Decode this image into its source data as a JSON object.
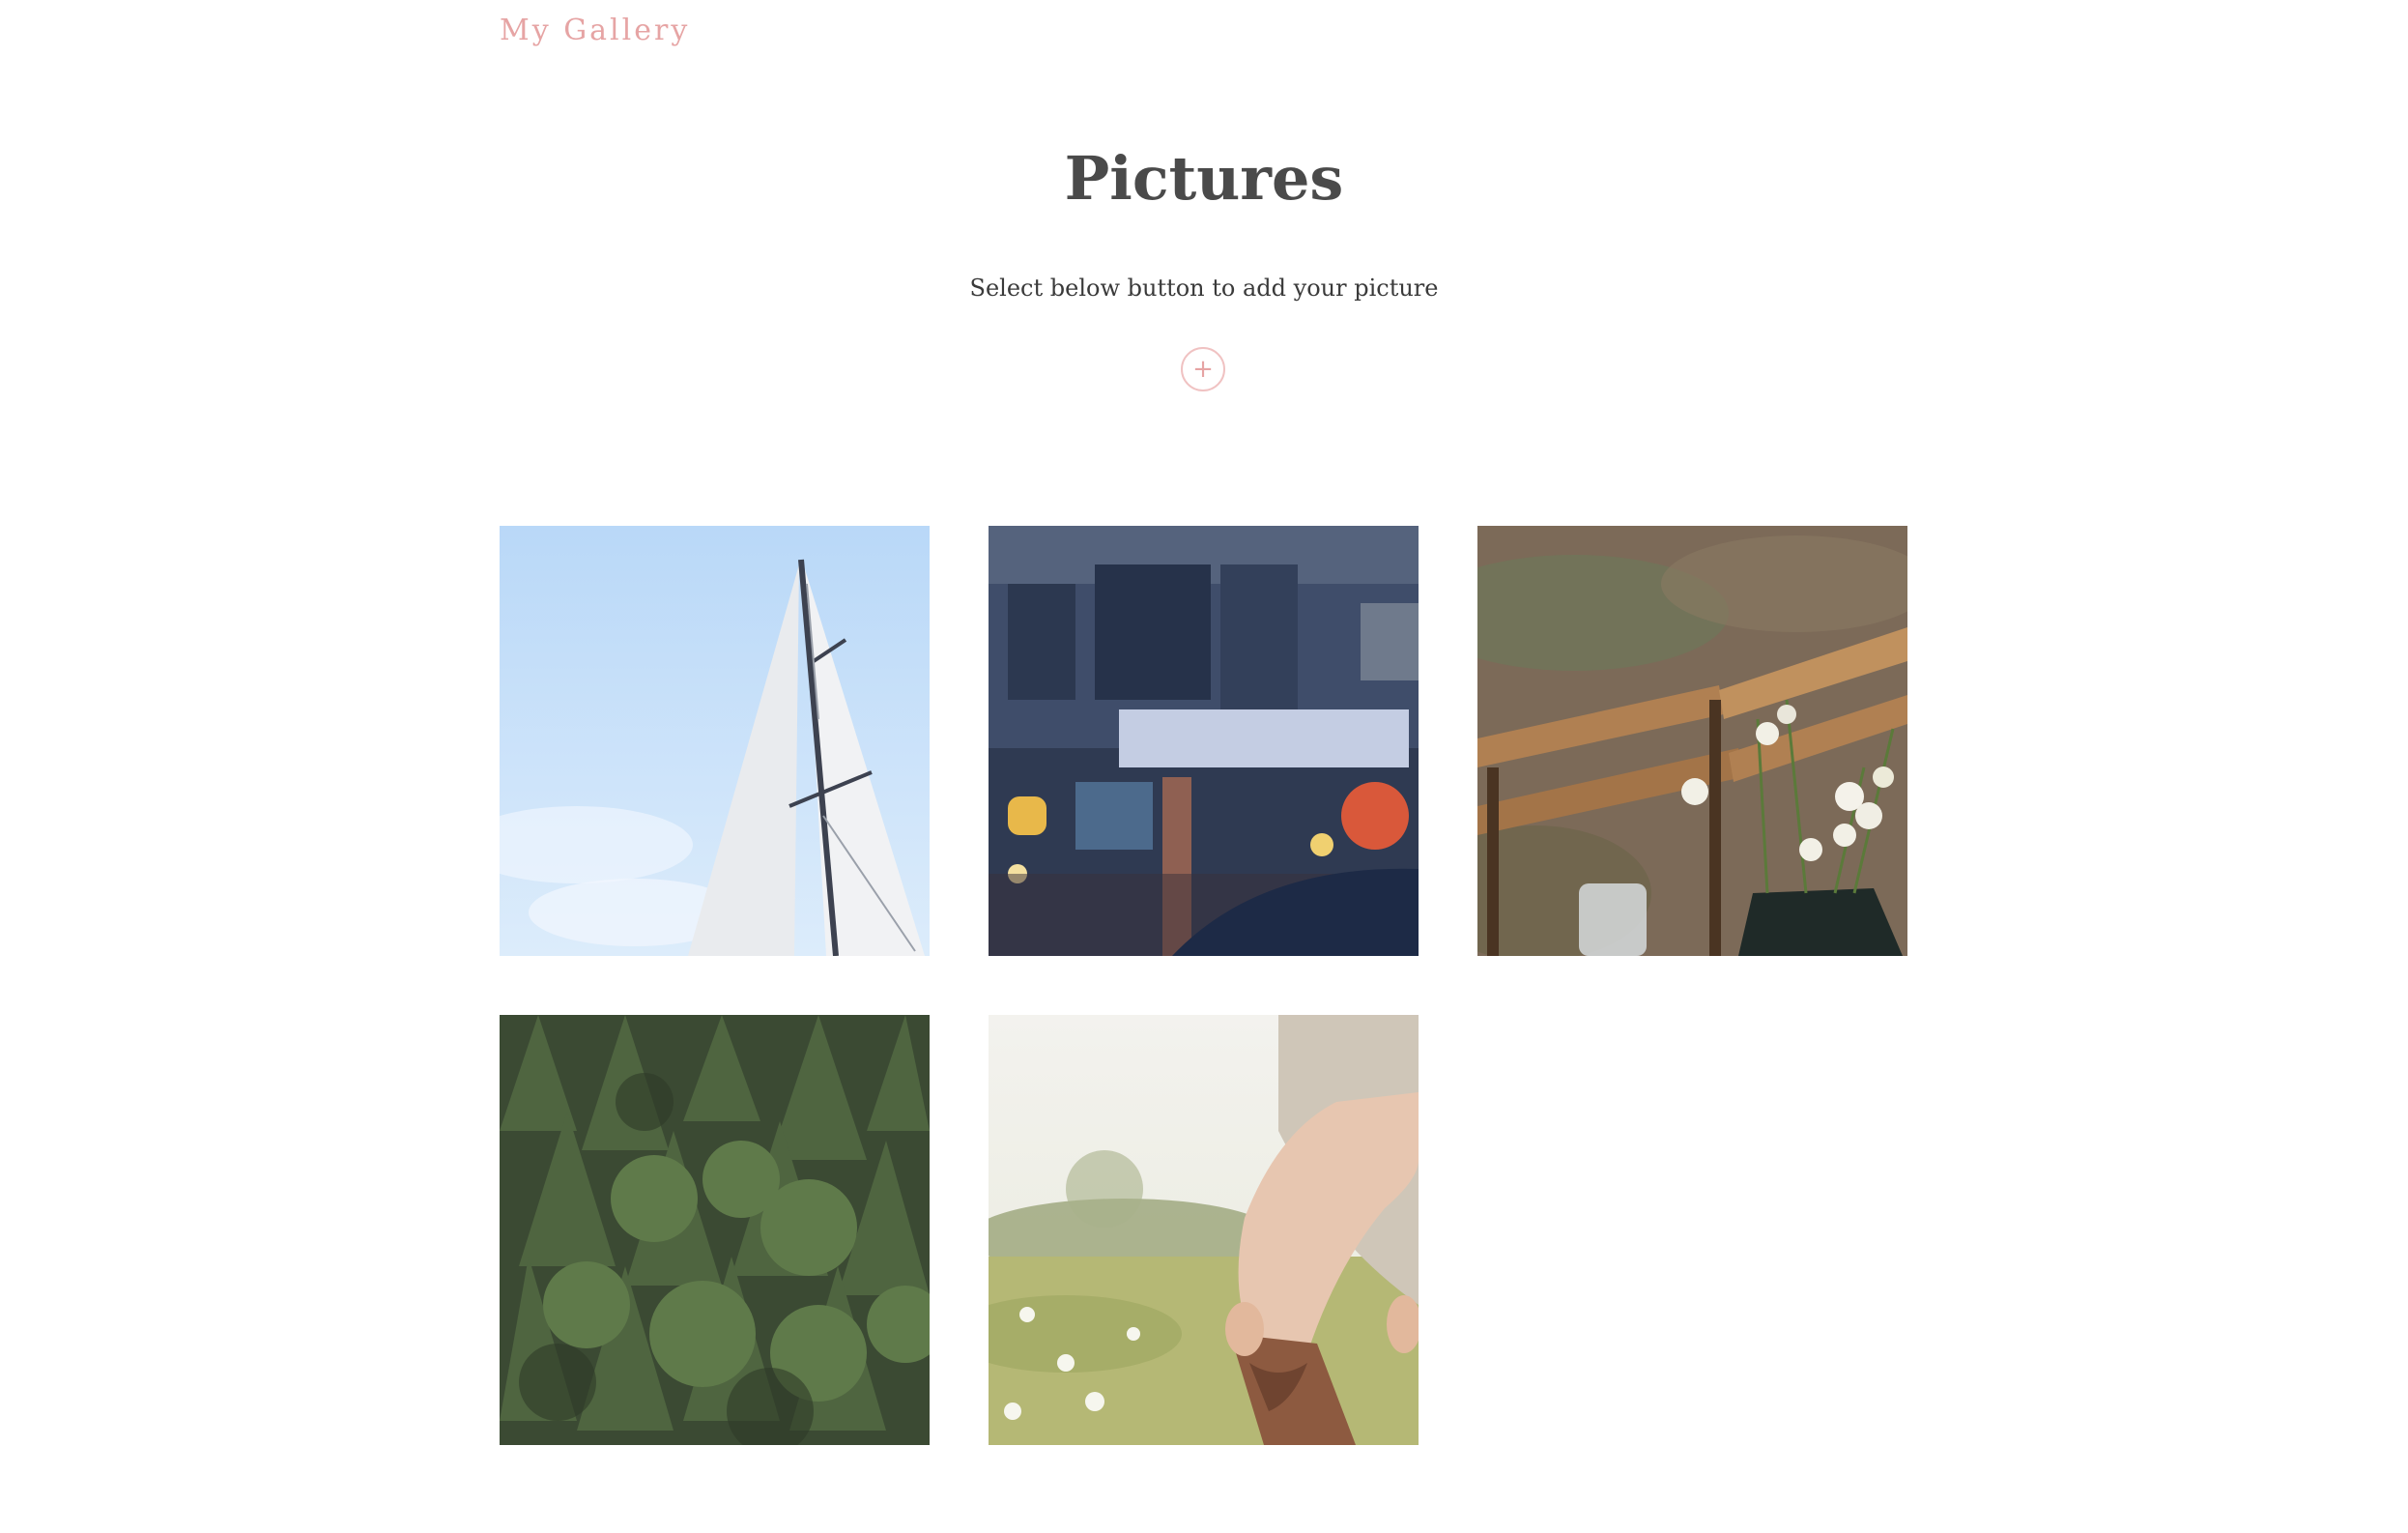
{
  "header": {
    "brand": "My Gallery"
  },
  "main": {
    "title": "Pictures",
    "subtitle": "Select below button to add your picture",
    "add_button_icon": "plus-icon",
    "add_button_symbol": "+"
  },
  "colors": {
    "accent": "#e6a4a4",
    "heading": "#4a4a4a",
    "text": "#3a3a3a"
  },
  "gallery": [
    {
      "subject": "sailboat-sails",
      "icon": "photo-sailboat"
    },
    {
      "subject": "city-street-umbrella",
      "icon": "photo-street"
    },
    {
      "subject": "flowers-on-table",
      "icon": "photo-flowers"
    },
    {
      "subject": "pine-forest",
      "icon": "photo-forest"
    },
    {
      "subject": "woman-cowboy-boot-meadow",
      "icon": "photo-boots"
    }
  ]
}
